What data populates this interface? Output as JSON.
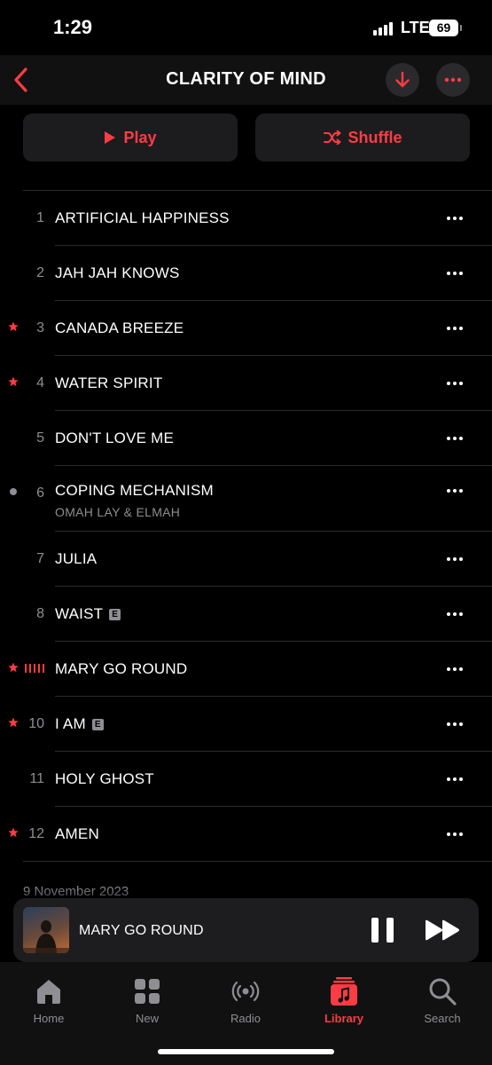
{
  "status_bar": {
    "time": "1:29",
    "network": "LTE",
    "battery": "69"
  },
  "header": {
    "title": "CLARITY OF MIND",
    "back_icon": "chevron-left-icon",
    "download_icon": "download-arrow-icon",
    "more_icon": "ellipsis-icon"
  },
  "actions": {
    "play_label": "Play",
    "shuffle_label": "Shuffle"
  },
  "tracks": [
    {
      "number": "1",
      "title": "ARTIFICIAL HAPPINESS",
      "favorite": false,
      "explicit": false
    },
    {
      "number": "2",
      "title": "JAH JAH KNOWS",
      "favorite": false,
      "explicit": false
    },
    {
      "number": "3",
      "title": "CANADA BREEZE",
      "favorite": true,
      "explicit": false
    },
    {
      "number": "4",
      "title": "WATER SPIRIT",
      "favorite": true,
      "explicit": false
    },
    {
      "number": "5",
      "title": "DON'T LOVE ME",
      "favorite": false,
      "explicit": false
    },
    {
      "number": "6",
      "title": "COPING MECHANISM",
      "artist": "OMAH LAY & ELMAH",
      "favorite": false,
      "explicit": false,
      "indicator": "dot"
    },
    {
      "number": "7",
      "title": "JULIA",
      "favorite": false,
      "explicit": false
    },
    {
      "number": "8",
      "title": "WAIST",
      "favorite": false,
      "explicit": true
    },
    {
      "number": "",
      "title": "MARY GO ROUND",
      "favorite": true,
      "explicit": false,
      "now_playing": true
    },
    {
      "number": "10",
      "title": "I AM",
      "favorite": true,
      "explicit": true
    },
    {
      "number": "11",
      "title": "HOLY GHOST",
      "favorite": false,
      "explicit": false
    },
    {
      "number": "12",
      "title": "AMEN",
      "favorite": true,
      "explicit": false
    }
  ],
  "explicit_badge": "E",
  "release_date": "9 November 2023",
  "mini_player": {
    "title": "MARY GO ROUND",
    "state": "playing"
  },
  "tab_bar": [
    {
      "label": "Home",
      "icon": "house-icon",
      "active": false
    },
    {
      "label": "New",
      "icon": "grid-icon",
      "active": false
    },
    {
      "label": "Radio",
      "icon": "radio-waves-icon",
      "active": false
    },
    {
      "label": "Library",
      "icon": "music-library-icon",
      "active": true
    },
    {
      "label": "Search",
      "icon": "magnifier-icon",
      "active": false
    }
  ],
  "colors": {
    "accent": "#fc3c44",
    "background": "#000000",
    "secondary_text": "#8e8e93"
  }
}
